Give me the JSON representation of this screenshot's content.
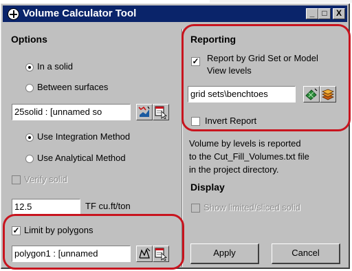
{
  "window": {
    "title": "Volume Calculator Tool",
    "minimize_label": "_",
    "maximize_label": "□",
    "close_label": "X"
  },
  "options": {
    "heading": "Options",
    "radio_in_solid": "In a solid",
    "radio_between_surfaces": "Between surfaces",
    "solid_field_value": "25solid : [unnamed so",
    "radio_integration": "Use Integration Method",
    "radio_analytical": "Use Analytical Method",
    "verify_solid_label": "Verify solid",
    "density_value": "12.5",
    "density_unit_label": "TF  cu.ft/ton",
    "limit_polygons_label": "Limit by polygons",
    "polygon_field_value": "polygon1 : [unnamed",
    "selected_mode": "In a solid",
    "selected_method": "Use Integration Method",
    "verify_solid_checked": false,
    "limit_polygons_checked": true
  },
  "reporting": {
    "heading": "Reporting",
    "report_by_grid_label_1": "Report by Grid Set or Model",
    "report_by_grid_label_2": "View levels",
    "report_by_grid_checked": true,
    "grid_field_value": "grid sets\\benchtoes",
    "invert_report_label": "Invert Report",
    "invert_report_checked": false,
    "info_line_1": "Volume by levels is reported",
    "info_line_2": "to  the Cut_Fill_Volumes.txt file",
    "info_line_3": "in the project directory."
  },
  "display": {
    "heading": "Display",
    "show_limited_label": "Show limited/sliced solid",
    "show_limited_checked": false
  },
  "buttons": {
    "apply": "Apply",
    "cancel": "Cancel"
  },
  "colors": {
    "titlebar": "#0a246a",
    "highlight_oval": "#c8141e",
    "dialog_face": "#c0c0c0"
  },
  "icons": [
    "app-icon",
    "pick-solid-icon",
    "select-list-icon",
    "pick-grid-icon",
    "layers-icon",
    "pick-polygon-icon"
  ]
}
